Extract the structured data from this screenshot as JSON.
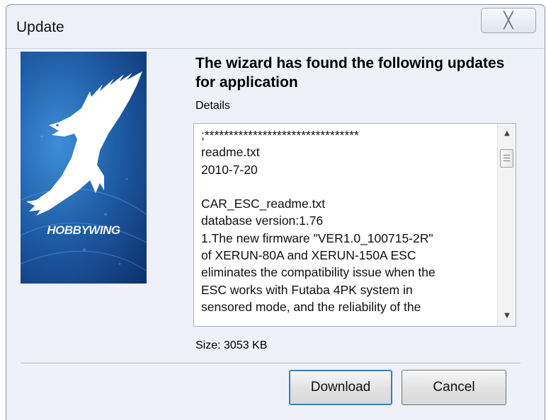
{
  "window": {
    "title": "Update",
    "close_glyph": "╳"
  },
  "logo": {
    "brand_text": "HOBBYWING",
    "icon": "eagle-logo"
  },
  "heading": "The wizard has found the following updates for application",
  "details_label": "Details",
  "details_text": ";********************************\nreadme.txt\n2010-7-20\n\nCAR_ESC_readme.txt\ndatabase version:1.76\n1.The new firmware \"VER1.0_100715-2R\"\nof XERUN-80A and XERUN-150A ESC\neliminates the compatibility issue when the\nESC works with Futaba 4PK system in\nsensored mode, and the reliability of the",
  "scrollbar": {
    "up_glyph": "▲",
    "down_glyph": "▼"
  },
  "size_label": "Size: 3053 KB",
  "buttons": {
    "download": "Download",
    "cancel": "Cancel"
  },
  "colors": {
    "window_bg": "#eef2f8",
    "logo_blue": "#1f5fa8",
    "default_button_border": "#3c7fb1"
  }
}
